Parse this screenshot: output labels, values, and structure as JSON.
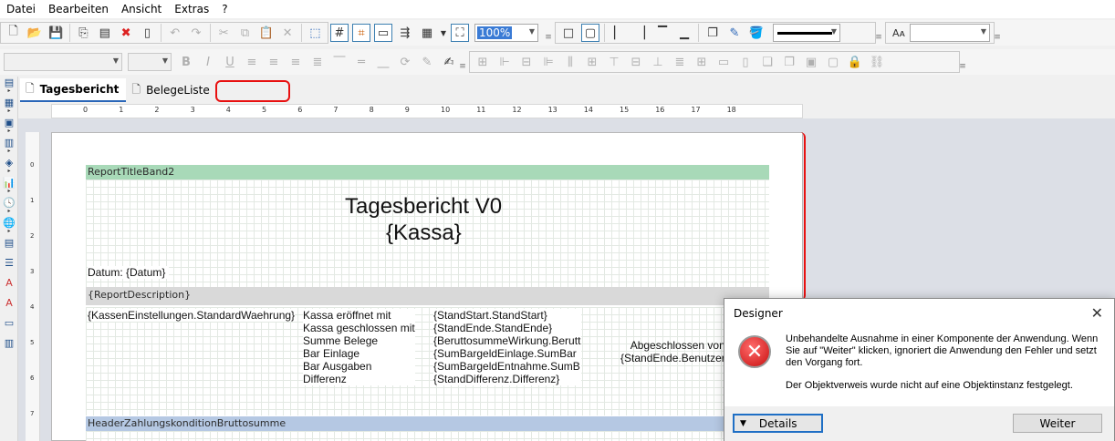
{
  "menu": [
    "Datei",
    "Bearbeiten",
    "Ansicht",
    "Extras",
    "?"
  ],
  "toolbar": {
    "zoom": "100%",
    "icons_row1": [
      "new-icon",
      "open-icon",
      "save-icon",
      "copy-page-icon",
      "new-page-icon",
      "delete-page-icon",
      "page-setup-icon",
      "undo-icon",
      "redo-icon",
      "cut-icon",
      "copy-icon",
      "paste-icon",
      "delete-icon",
      "select-icon",
      "grid-icon",
      "align-grid-icon",
      "page-icon",
      "band-icon",
      "objects-icon",
      "zoom-icon"
    ]
  },
  "tabs": [
    {
      "label": "Tagesbericht",
      "active": true
    },
    {
      "label": "BelegeListe",
      "active": false
    }
  ],
  "ruler": [
    "0",
    "1",
    "2",
    "3",
    "4",
    "5",
    "6",
    "7",
    "8",
    "9",
    "10",
    "11",
    "12",
    "13",
    "14",
    "15",
    "16",
    "17",
    "18"
  ],
  "vruler": [
    "0",
    "1",
    "2",
    "3",
    "4",
    "5",
    "6",
    "7"
  ],
  "report": {
    "band_title": "ReportTitleBand2",
    "title_line1": "Tagesbericht V0",
    "title_line2": "{Kassa}",
    "datum": "Datum: {Datum}",
    "band_description": "{ReportDescription}",
    "currency": "{KassenEinstellungen.StandardWaehrung}",
    "labels": "Kassa eröffnet mit\nKassa geschlossen mit\nSumme Belege\nBar Einlage\nBar Ausgaben\nDifferenz",
    "values": "{StandStart.StandStart}\n{StandEnde.StandEnde}\n{BeruttosummeWirkung.Berutt\n{SumBargeldEinlage.SumBar\n{SumBargeldEntnahme.SumB\n{StandDifferenz.Differenz}",
    "abgeschlossen": "Abgeschlossen von\n{StandEnde.Benutzer",
    "band_header": "HeaderZahlungskonditionBruttosumme"
  },
  "dialog": {
    "title": "Designer",
    "message": "Unbehandelte Ausnahme in einer Komponente der Anwendung. Wenn Sie auf \"Weiter\" klicken, ignoriert die Anwendung den Fehler und setzt den Vorgang fort.",
    "detail": "Der Objektverweis wurde nicht auf eine Objektinstanz festgelegt.",
    "details_button": "Details",
    "continue_button": "Weiter"
  },
  "colors": {
    "band_title": "#a8d9b8",
    "band_description": "#d9d9d9",
    "band_header": "#b5c8e3",
    "annotation": "#e81010",
    "tab_active_underline": "#2a66b8"
  }
}
